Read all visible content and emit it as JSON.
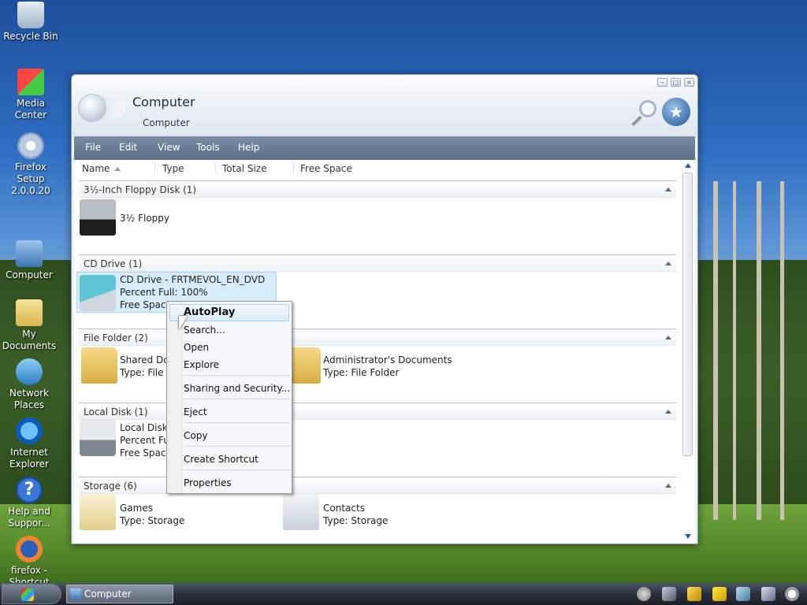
{
  "desktop": {
    "icons": [
      {
        "label": "Recycle Bin"
      },
      {
        "label": "Media Center"
      },
      {
        "label": "Firefox Setup 2.0.0.20"
      },
      {
        "label": "Computer"
      },
      {
        "label": "My Documents"
      },
      {
        "label": "Network Places"
      },
      {
        "label": "Internet Explorer"
      },
      {
        "label": "Help and Suppor..."
      },
      {
        "label": "firefox - Shortcut"
      }
    ]
  },
  "window": {
    "title": "Computer",
    "subtitle": "Computer",
    "controls": {
      "minimize": "–",
      "maximize": "□",
      "close": "×"
    },
    "menu": [
      "File",
      "Edit",
      "View",
      "Tools",
      "Help"
    ],
    "columns": [
      "Name",
      "Type",
      "Total Size",
      "Free Space"
    ],
    "groups": [
      {
        "header": "3½-Inch Floppy Disk (1)"
      },
      {
        "header": "CD Drive (1)"
      },
      {
        "header": "File Folder (2)"
      },
      {
        "header": "Local Disk (1)"
      },
      {
        "header": "Storage (6)"
      }
    ],
    "items": {
      "floppy": {
        "name": "3½ Floppy"
      },
      "cd": {
        "name": "CD Drive - FRTMEVOL_EN_DVD",
        "line2": "Percent Full: 100%",
        "line3": "Free Space:"
      },
      "shared": {
        "name": "Shared Doc",
        "line2": "Type: File Fo"
      },
      "admin": {
        "name": "Administrator's Documents",
        "line2": "Type: File Folder"
      },
      "local": {
        "name": "Local Disk",
        "line2": "Percent Full",
        "line3": "Free Space:"
      },
      "games": {
        "name": "Games",
        "line2": "Type: Storage"
      },
      "contacts": {
        "name": "Contacts",
        "line2": "Type: Storage"
      }
    }
  },
  "context_menu": {
    "items": [
      "AutoPlay",
      "Search...",
      "Open",
      "Explore",
      "Sharing and Security...",
      "Eject",
      "Copy",
      "Create Shortcut",
      "Properties"
    ]
  },
  "taskbar": {
    "task": "Computer"
  }
}
